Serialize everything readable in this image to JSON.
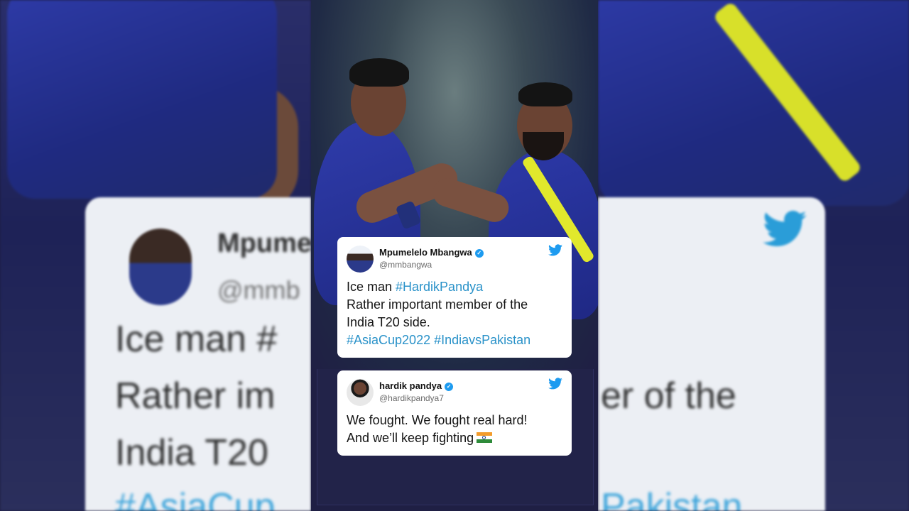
{
  "background": {
    "ghost_lines": [
      "Mpume",
      "@mmb",
      "Ice man #",
      "Rather im",
      "India T20",
      "#AsiaCup",
      "er of the",
      "Pakistan"
    ]
  },
  "tweets": [
    {
      "author": "Mpumelelo Mbangwa",
      "handle": "@mmbangwa",
      "line1_text": "Ice man ",
      "line1_tag": "#HardikPandya",
      "line2": "Rather important member of the",
      "line3": "India T20 side.",
      "line4_tag1": "#AsiaCup2022",
      "line4_tag2": "#IndiavsPakistan"
    },
    {
      "author": "hardik pandya",
      "handle": "@hardikpandya7",
      "line1": "We fought. We fought real hard!",
      "line2": "And we’ll keep fighting"
    }
  ],
  "icons": {
    "verified": "verified-badge-icon",
    "platform": "twitter-bird-icon",
    "flag": "india-flag-icon"
  },
  "colors": {
    "hashtag": "#2a92c9",
    "twitter_blue": "#1d9bf0",
    "jersey_blue": "#2b3aa5"
  }
}
